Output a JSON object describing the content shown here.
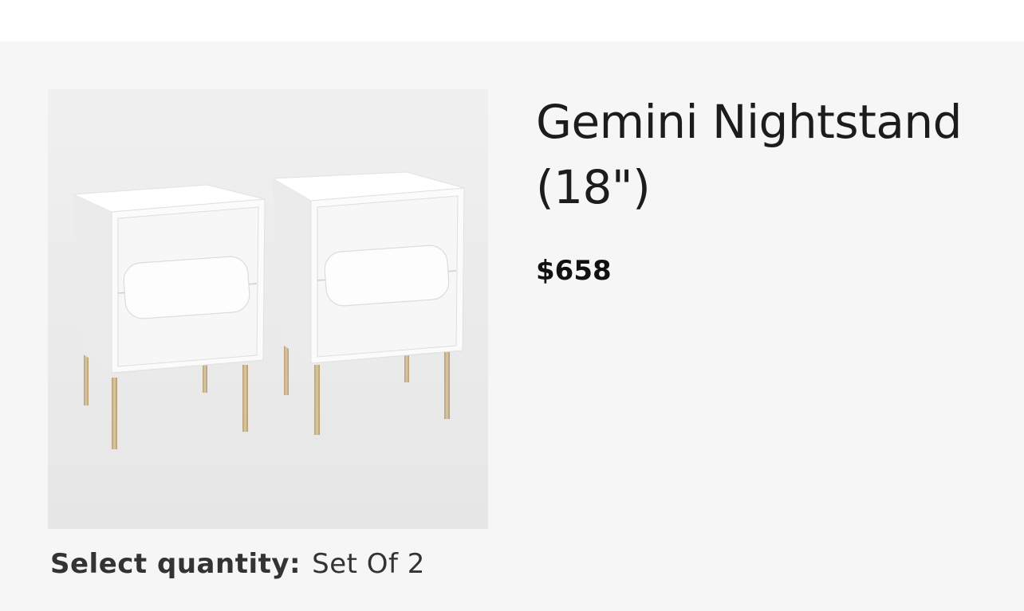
{
  "product": {
    "title": "Gemini Nightstand (18\")",
    "price": "$658",
    "image_icon": "nightstand-pair-image"
  },
  "quantity": {
    "label": "Select quantity:",
    "value": "Set Of 2"
  },
  "colors": {
    "page_background": "#f6f6f6",
    "image_background": "#eeeeee",
    "furniture_white": "#fbfbfb",
    "leg_brass": "#c9b48f",
    "text": "#1c1c1c"
  }
}
